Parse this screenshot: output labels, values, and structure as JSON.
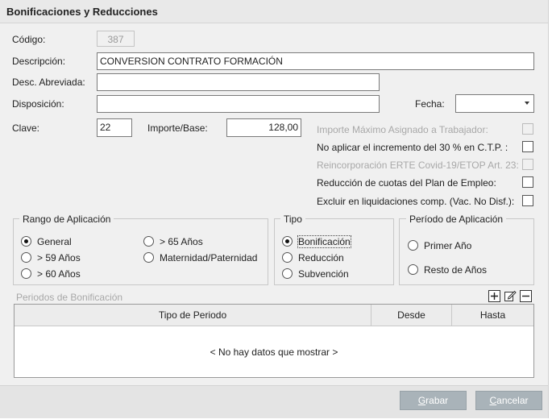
{
  "window": {
    "title": "Bonificaciones y Reducciones"
  },
  "fields": {
    "codigo": {
      "label": "Código:",
      "value": "387"
    },
    "descripcion": {
      "label": "Descripción:",
      "value": "CONVERSION CONTRATO FORMACIÓN"
    },
    "desc_abreviada": {
      "label": "Desc. Abreviada:",
      "value": ""
    },
    "disposicion": {
      "label": "Disposición:",
      "value": ""
    },
    "fecha": {
      "label": "Fecha:",
      "value": ""
    },
    "clave": {
      "label": "Clave:",
      "value": "22"
    },
    "importe_base": {
      "label": "Importe/Base:",
      "value": "128,00"
    }
  },
  "checks": [
    {
      "label": "Importe Máximo Asignado a Trabajador:",
      "enabled": false,
      "checked": false
    },
    {
      "label": "No aplicar el incremento del 30 % en C.T.P. :",
      "enabled": true,
      "checked": false
    },
    {
      "label": "Reincorporación ERTE Covid-19/ETOP Art. 23:",
      "enabled": false,
      "checked": false
    },
    {
      "label": "Reducción de cuotas del Plan de Empleo:",
      "enabled": true,
      "checked": false
    },
    {
      "label": "Excluir en liquidaciones comp.  (Vac. No Disf.):",
      "enabled": true,
      "checked": false
    }
  ],
  "rango": {
    "title": "Rango de Aplicación",
    "options": [
      "General",
      "> 59 Años",
      "> 60 Años",
      "> 65 Años",
      "Maternidad/Paternidad"
    ],
    "selected": "General"
  },
  "tipo": {
    "title": "Tipo",
    "options": [
      "Bonificación",
      "Reducción",
      "Subvención"
    ],
    "selected": "Bonificación"
  },
  "periodo": {
    "title": "Período de Aplicación",
    "options": [
      "Primer Año",
      "Resto de Años"
    ],
    "selected": ""
  },
  "periodos_grid": {
    "title": "Periodos de Bonificación",
    "columns": [
      "Tipo de Periodo",
      "Desde",
      "Hasta"
    ],
    "empty_text": "< No hay datos que mostrar >",
    "toolbar": [
      "add-icon",
      "edit-icon",
      "remove-icon"
    ]
  },
  "buttons": {
    "grabar": {
      "first": "G",
      "rest": "rabar"
    },
    "cancelar": {
      "first": "C",
      "rest": "ancelar"
    }
  }
}
